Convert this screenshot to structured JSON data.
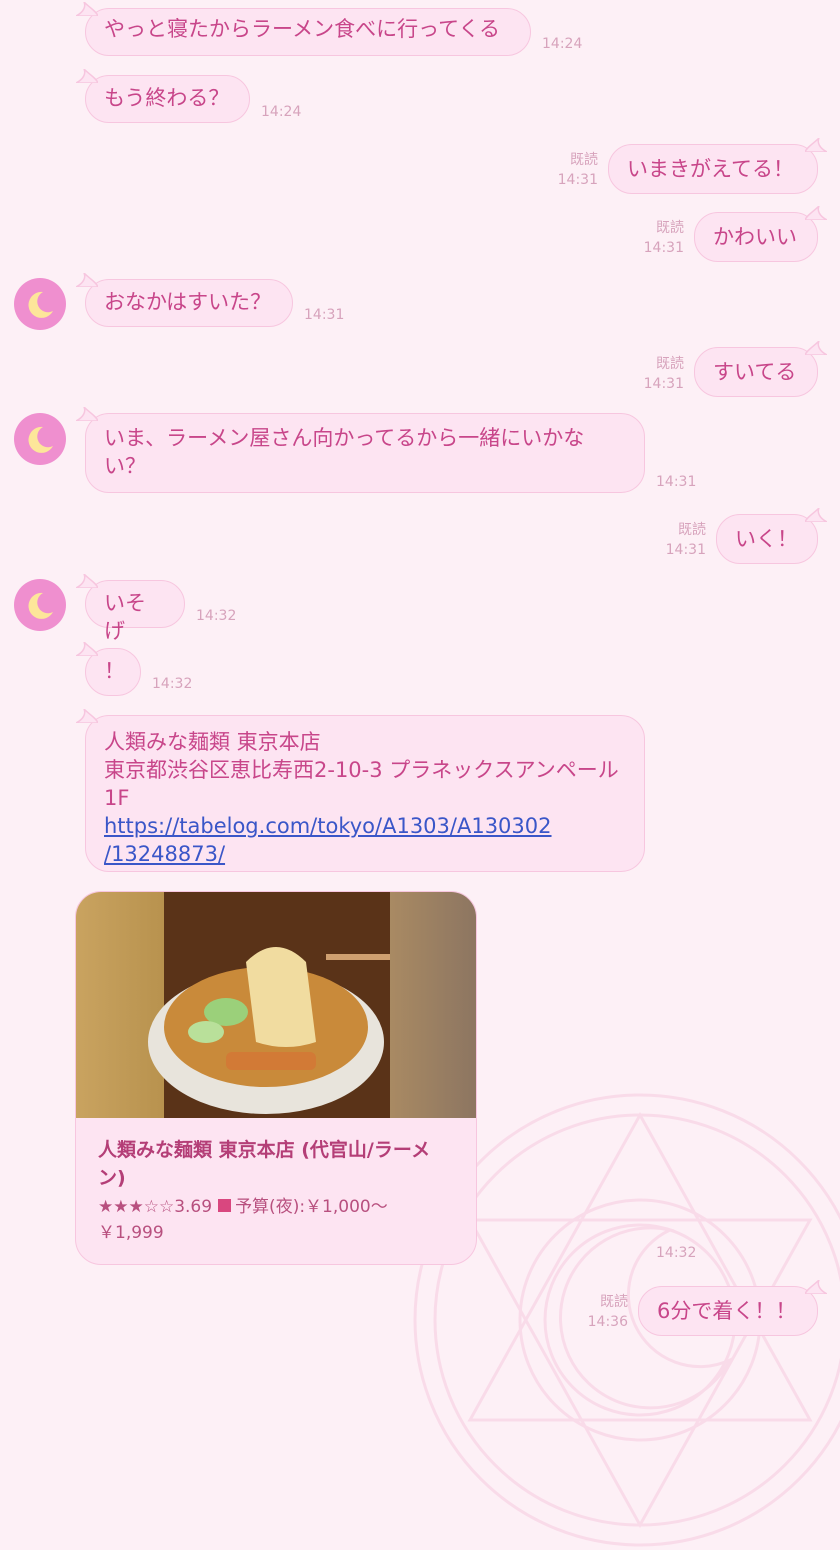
{
  "messages": [
    {
      "text": "やっと寝たからラーメン食べに行ってくる",
      "time": "14:24"
    },
    {
      "text": "もう終わる？",
      "time": "14:24"
    },
    {
      "text": "いまきがえてる！",
      "time": "14:31",
      "read": "既読"
    },
    {
      "text": "かわいい",
      "time": "14:31",
      "read": "既読"
    },
    {
      "text": "おなかはすいた？",
      "time": "14:31"
    },
    {
      "text": "すいてる",
      "time": "14:31",
      "read": "既読"
    },
    {
      "text": "いま、ラーメン屋さん向かってるから一緒にいかな",
      "text2": "い？",
      "time": "14:31"
    },
    {
      "text": "いく！",
      "time": "14:31",
      "read": "既読"
    },
    {
      "text": "いそげ",
      "time": "14:32"
    },
    {
      "text": "！",
      "time": "14:32"
    },
    {
      "text": "人類みな麺類 東京本店",
      "text2": "東京都渋谷区恵比寿西2-10-3 プラネックスアンペール",
      "text3": "1F",
      "link": "https://tabelog.com/tokyo/A1303/A130302",
      "link2": "/13248873/"
    },
    {
      "text": "6分で着く！！",
      "time": "14:36",
      "read": "既読"
    }
  ],
  "card": {
    "title_line1": "人類みな麺類 東京本店 (代官山/ラーメ",
    "title_line2": "ン)",
    "rating_stars": "★★★☆☆",
    "rating": "3.69",
    "budget": "予算(夜):￥1,000～",
    "budget2": "￥1,999",
    "time": "14:32"
  }
}
